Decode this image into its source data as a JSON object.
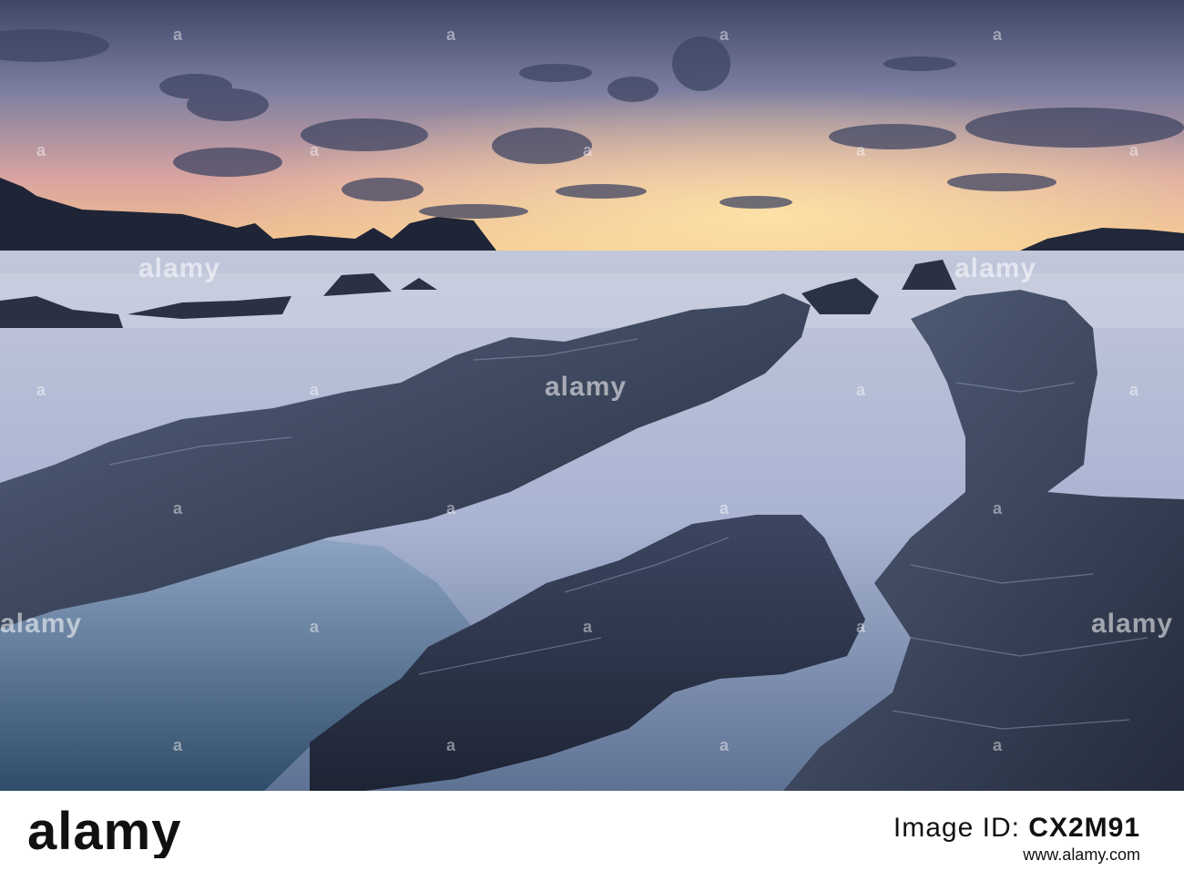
{
  "watermark": {
    "text": "alamy",
    "positions_note": ""
  },
  "footer": {
    "logo_text": "alamy",
    "id_label": "Image ID: ",
    "id_value": "CX2M91",
    "url": "www.alamy.com"
  },
  "colors": {
    "sky_top": "#4a5578",
    "sky_glow": "#f0b27a",
    "sea": "#aeb8d3",
    "rock": "#2a3346"
  }
}
